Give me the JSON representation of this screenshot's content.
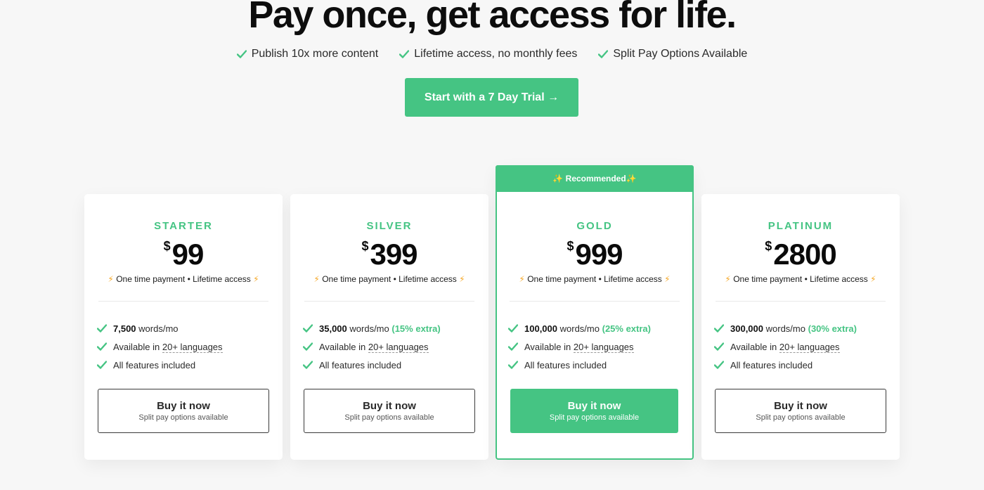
{
  "headline": "Pay once, get access for life.",
  "benefits": [
    "Publish 10x more content",
    "Lifetime access, no monthly fees",
    "Split Pay Options Available"
  ],
  "trial_button": "Start with a 7 Day Trial →",
  "colors": {
    "accent": "#45c483",
    "bolt": "#f5a623",
    "background": "#f7f7f7"
  },
  "icons": {
    "check": "check-icon",
    "bolt": "lightning-icon",
    "sparkle": "sparkle-icon"
  },
  "plans": [
    {
      "name": "STARTER",
      "currency": "$",
      "price": "99",
      "payment_note": "One time payment • Lifetime access",
      "words": "7,500",
      "words_unit": "words/mo",
      "extra": "",
      "languages_prefix": "Available in ",
      "languages": "20+ languages",
      "features_note": "All features included",
      "buy_label": "Buy it now",
      "buy_sub": "Split pay options available"
    },
    {
      "name": "SILVER",
      "currency": "$",
      "price": "399",
      "payment_note": "One time payment • Lifetime access",
      "words": "35,000",
      "words_unit": "words/mo",
      "extra": "(15% extra)",
      "languages_prefix": "Available in ",
      "languages": "20+ languages",
      "features_note": "All features included",
      "buy_label": "Buy it now",
      "buy_sub": "Split pay options available"
    },
    {
      "name": "GOLD",
      "badge": "✨ Recommended✨",
      "currency": "$",
      "price": "999",
      "payment_note": "One time payment • Lifetime access",
      "words": "100,000",
      "words_unit": "words/mo",
      "extra": "(25% extra)",
      "languages_prefix": "Available in ",
      "languages": "20+ languages",
      "features_note": "All features included",
      "buy_label": "Buy it now",
      "buy_sub": "Split pay options available"
    },
    {
      "name": "PLATINUM",
      "currency": "$",
      "price": "2800",
      "payment_note": "One time payment • Lifetime access",
      "words": "300,000",
      "words_unit": "words/mo",
      "extra": "(30% extra)",
      "languages_prefix": "Available in ",
      "languages": "20+ languages",
      "features_note": "All features included",
      "buy_label": "Buy it now",
      "buy_sub": "Split pay options available"
    }
  ]
}
